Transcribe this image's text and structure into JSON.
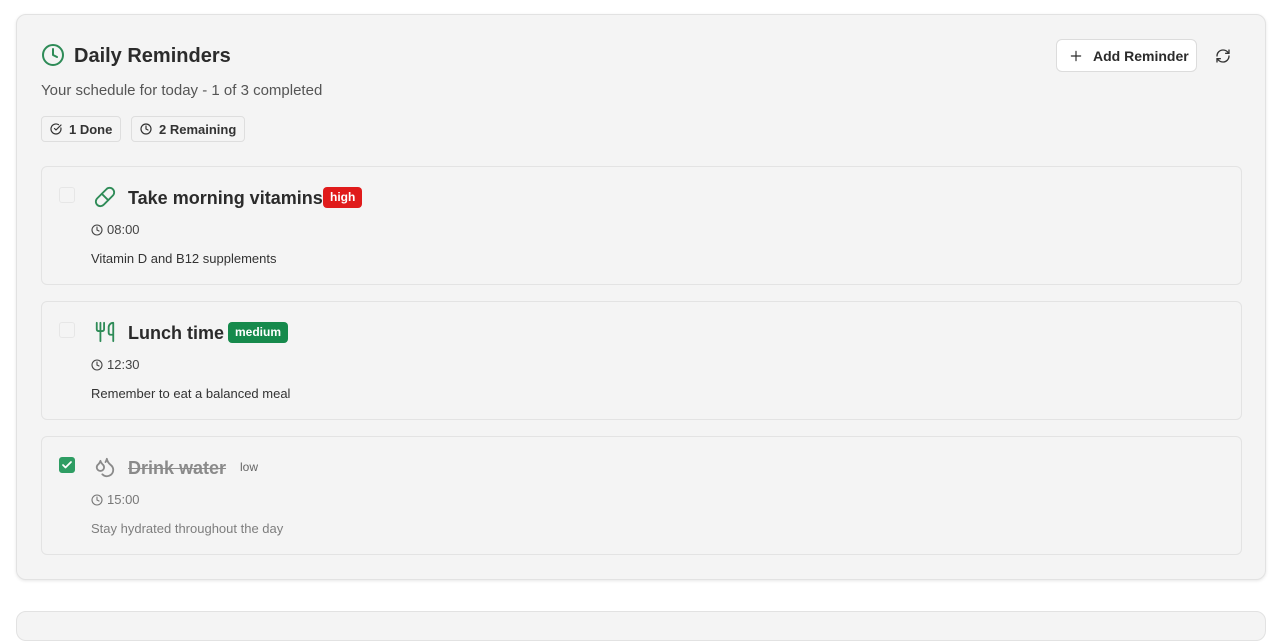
{
  "header": {
    "title": "Daily Reminders",
    "subtitle": "Your schedule for today - 1 of 3 completed",
    "accent_color": "#2e8b57",
    "add_label": "Add Reminder"
  },
  "stats": {
    "done_label": "1 Done",
    "remaining_label": "2 Remaining"
  },
  "reminders": [
    {
      "title": "Take morning vitamins",
      "priority": "high",
      "priority_color": "#e01b1b",
      "time": "08:00",
      "description": "Vitamin D and B12 supplements",
      "icon": "pill-icon",
      "completed": false
    },
    {
      "title": "Lunch time",
      "priority": "medium",
      "priority_color": "#168a4c",
      "time": "12:30",
      "description": "Remember to eat a balanced meal",
      "icon": "utensils-icon",
      "completed": false
    },
    {
      "title": "Drink water",
      "priority": "low",
      "priority_color": "#666666",
      "time": "15:00",
      "description": "Stay hydrated throughout the day",
      "icon": "droplets-icon",
      "completed": true
    }
  ]
}
